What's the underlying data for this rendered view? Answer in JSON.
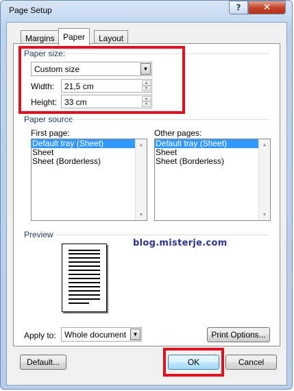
{
  "window": {
    "title": "Page Setup",
    "help_glyph": "?",
    "close_glyph": "✕"
  },
  "tabs": [
    {
      "label": "Margins"
    },
    {
      "label": "Paper"
    },
    {
      "label": "Layout"
    }
  ],
  "paper_size": {
    "group_label": "Paper size:",
    "selected": "Custom size",
    "width_label": "Width:",
    "width_value": "21,5 cm",
    "height_label": "Height:",
    "height_value": "33 cm"
  },
  "paper_source": {
    "group_label": "Paper source",
    "first_page_label": "First page:",
    "first_page_items": [
      "Default tray (Sheet)",
      "Sheet",
      "Sheet (Borderless)"
    ],
    "other_pages_label": "Other pages:",
    "other_pages_items": [
      "Default tray (Sheet)",
      "Sheet",
      "Sheet (Borderless)"
    ]
  },
  "preview": {
    "group_label": "Preview",
    "watermark": "blog.misterje.com"
  },
  "apply_to": {
    "label": "Apply to:",
    "selected": "Whole document"
  },
  "buttons": {
    "print_options": "Print Options...",
    "default": "Default...",
    "ok": "OK",
    "cancel": "Cancel"
  },
  "colors": {
    "highlight": "#e0101e",
    "selection": "#3399ff",
    "watermark": "#2e3192"
  }
}
